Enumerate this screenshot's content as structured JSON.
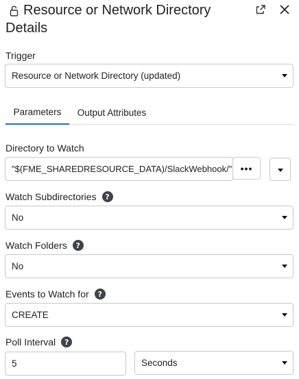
{
  "header": {
    "title_line1": "Resource or Network Directory",
    "title_line2": "Details",
    "lock_icon": "unlock-icon",
    "popout_icon": "popout-icon",
    "close_icon": "close-icon"
  },
  "trigger": {
    "label": "Trigger",
    "value": "Resource or Network Directory (updated)"
  },
  "tabs": [
    {
      "label": "Parameters",
      "active": true
    },
    {
      "label": "Output Attributes",
      "active": false
    }
  ],
  "directory": {
    "label": "Directory to Watch",
    "value": "\"$(FME_SHAREDRESOURCE_DATA)/SlackWebhook/\"",
    "browse_label": "•••"
  },
  "watch_subdirectories": {
    "label": "Watch Subdirectories",
    "value": "No"
  },
  "watch_folders": {
    "label": "Watch Folders",
    "value": "No"
  },
  "events": {
    "label": "Events to Watch for",
    "value": "CREATE"
  },
  "poll_interval": {
    "label": "Poll Interval",
    "value": "5",
    "unit": "Seconds"
  },
  "colors": {
    "active_tab": "#2a6db0",
    "help_icon_bg": "#3f4347",
    "border": "#c9c9c9"
  }
}
